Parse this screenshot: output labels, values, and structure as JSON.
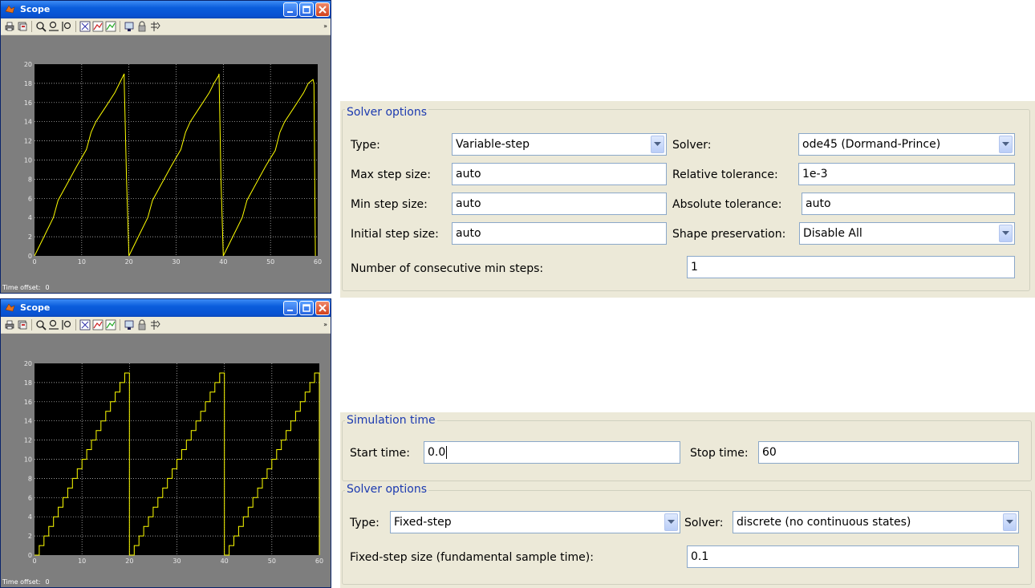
{
  "scope1": {
    "title": "Scope",
    "time_offset_label": "Time offset:",
    "time_offset_value": "0",
    "toolbar_icons": [
      "print-icon",
      "parameters-icon",
      "zoom-icon",
      "zoom-x-icon",
      "zoom-y-icon",
      "autoscale-icon",
      "save-axes-icon",
      "restore-axes-icon",
      "floating-scope-icon",
      "lock-axes-icon",
      "signal-selection-icon"
    ],
    "chart_data": {
      "type": "line",
      "xlim": [
        0,
        60
      ],
      "ylim": [
        0,
        20
      ],
      "xticks": [
        "0",
        "10",
        "20",
        "30",
        "40",
        "50",
        "60"
      ],
      "yticks": [
        "0",
        "2",
        "4",
        "6",
        "8",
        "10",
        "12",
        "14",
        "16",
        "18",
        "20"
      ],
      "grid": true,
      "series": [
        {
          "color": "#ffff00",
          "x": [
            0,
            2,
            4,
            5,
            7,
            9,
            11,
            12,
            13,
            15,
            17,
            18,
            19,
            19,
            19.5,
            20,
            22,
            24,
            25,
            27,
            29,
            31,
            32,
            33,
            35,
            37,
            38,
            39,
            39.1,
            39.5,
            40,
            42,
            44,
            45,
            47,
            49,
            51,
            52,
            53,
            55,
            57,
            58,
            59,
            59.2,
            59.5
          ],
          "y": [
            0,
            2,
            4,
            5.8,
            7.6,
            9.4,
            11.1,
            12.9,
            14,
            15.5,
            17,
            18,
            19,
            18.2,
            8,
            0,
            2,
            4,
            5.8,
            7.6,
            9.4,
            11.1,
            12.9,
            14,
            15.5,
            17,
            18,
            18.8,
            19,
            8,
            0,
            2,
            4,
            5.8,
            7.6,
            9.4,
            11,
            12.9,
            14,
            15.5,
            17,
            18,
            18.4,
            18,
            0
          ]
        }
      ]
    }
  },
  "scope2": {
    "title": "Scope",
    "time_offset_label": "Time offset:",
    "time_offset_value": "0",
    "chart_data": {
      "type": "line",
      "step": true,
      "xlim": [
        0,
        60
      ],
      "ylim": [
        0,
        20
      ],
      "xticks": [
        "0",
        "10",
        "20",
        "30",
        "40",
        "50",
        "60"
      ],
      "yticks": [
        "0",
        "2",
        "4",
        "6",
        "8",
        "10",
        "12",
        "14",
        "16",
        "18",
        "20"
      ],
      "grid": true,
      "series": [
        {
          "color": "#ffff00",
          "period": 20,
          "step_dt": 1,
          "step_dy": 1,
          "max": 19
        }
      ]
    }
  },
  "solver_panel_1": {
    "legend": "Solver options",
    "type_label": "Type:",
    "type_value": "Variable-step",
    "solver_label": "Solver:",
    "solver_value": "ode45 (Dormand-Prince)",
    "max_step_label": "Max step size:",
    "max_step_value": "auto",
    "rel_tol_label": "Relative tolerance:",
    "rel_tol_value": "1e-3",
    "min_step_label": "Min step size:",
    "min_step_value": "auto",
    "abs_tol_label": "Absolute tolerance:",
    "abs_tol_value": "auto",
    "init_step_label": "Initial step size:",
    "init_step_value": "auto",
    "shape_label": "Shape preservation:",
    "shape_value": "Disable All",
    "consec_label": "Number of consecutive min steps:",
    "consec_value": "1"
  },
  "sim_time_panel": {
    "legend": "Simulation time",
    "start_label": "Start time:",
    "start_value": "0.0",
    "stop_label": "Stop time:",
    "stop_value": "60"
  },
  "solver_panel_2": {
    "legend": "Solver options",
    "type_label": "Type:",
    "type_value": "Fixed-step",
    "solver_label": "Solver:",
    "solver_value": "discrete (no continuous states)",
    "fixed_step_label": "Fixed-step size (fundamental sample time):",
    "fixed_step_value": "0.1"
  }
}
